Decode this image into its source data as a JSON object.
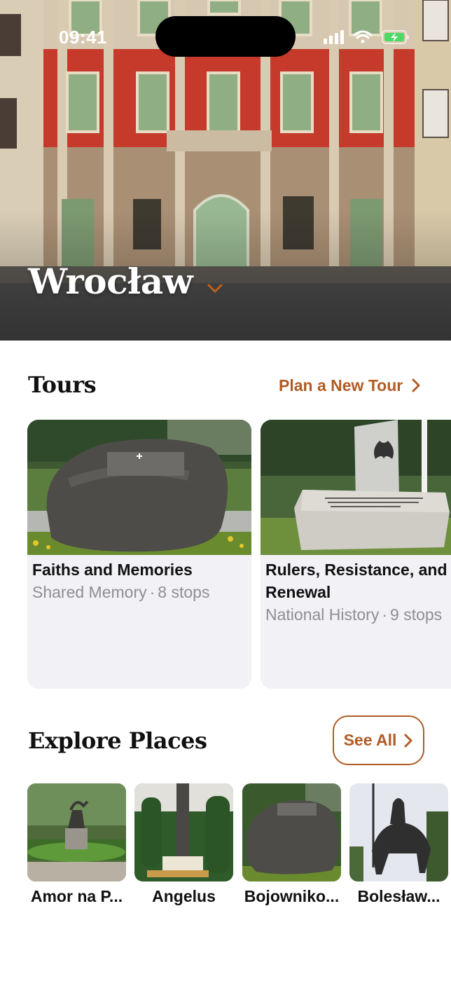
{
  "status_bar": {
    "time": "09:41"
  },
  "hero": {
    "city": "Wrocław"
  },
  "tours": {
    "title": "Tours",
    "plan_link": "Plan a New Tour",
    "cards": [
      {
        "title": "Faiths and Memories",
        "category": "Shared Memory",
        "separator": "·",
        "stops": "8 stops"
      },
      {
        "title": "Rulers, Resistance, and Renewal",
        "category": "National History",
        "separator": "·",
        "stops": "9 stops"
      }
    ]
  },
  "explore": {
    "title": "Explore Places",
    "see_all": "See All",
    "places": [
      {
        "name": "Amor na P..."
      },
      {
        "name": "Angelus"
      },
      {
        "name": "Bojowniko..."
      },
      {
        "name": "Bolesław..."
      }
    ]
  },
  "colors": {
    "accent": "#b15b24",
    "card_bg": "#f1f1f6",
    "secondary_text": "#8e8e93"
  },
  "icons": [
    "chevron-down-icon",
    "chevron-right-icon",
    "signal-icon",
    "wifi-icon",
    "battery-charging-icon"
  ]
}
